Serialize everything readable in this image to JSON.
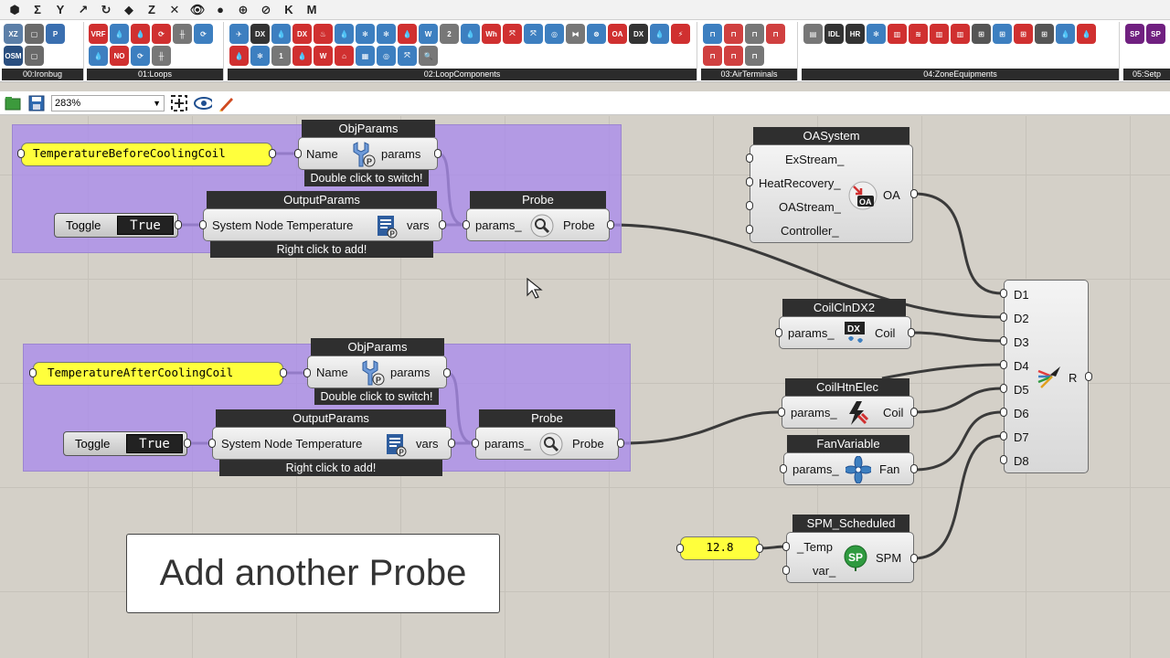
{
  "topbar": {
    "items": [
      "⬢",
      "Σ",
      "Y",
      "↗",
      "↻",
      "◆",
      "Z",
      "✕",
      "👁",
      "●",
      "⊕",
      "⊘",
      "K",
      "M"
    ]
  },
  "ribbon": {
    "groups": [
      {
        "label": "00:Ironbug",
        "color": "#3a6fb0"
      },
      {
        "label": "01:Loops",
        "color": "#d03030"
      },
      {
        "label": "02:LoopComponents",
        "color": "#3d7fc0"
      },
      {
        "label": "03:AirTerminals",
        "color": "#d04040"
      },
      {
        "label": "04:ZoneEquipments",
        "color": "#2f6aa8"
      },
      {
        "label": "05:Setp",
        "color": "#702080"
      }
    ]
  },
  "toolbar": {
    "zoom_value": "283%"
  },
  "canvas": {
    "group1": {
      "panel_text": "TemperatureBeforeCoolingCoil",
      "objparams": {
        "title": "ObjParams",
        "input": "Name",
        "output": "params",
        "footer": "Double click to switch!"
      },
      "toggle": {
        "label": "Toggle",
        "value": "True"
      },
      "outputparams": {
        "title": "OutputParams",
        "input": "System Node Temperature",
        "output": "vars",
        "footer": "Right click to add!"
      },
      "probe": {
        "title": "Probe",
        "input": "params_",
        "output": "Probe"
      }
    },
    "group2": {
      "panel_text": "TemperatureAfterCoolingCoil",
      "objparams": {
        "title": "ObjParams",
        "input": "Name",
        "output": "params",
        "footer": "Double click to switch!"
      },
      "toggle": {
        "label": "Toggle",
        "value": "True"
      },
      "outputparams": {
        "title": "OutputParams",
        "input": "System Node Temperature",
        "output": "vars",
        "footer": "Right click to add!"
      },
      "probe": {
        "title": "Probe",
        "input": "params_",
        "output": "Probe"
      }
    },
    "oasystem": {
      "title": "OASystem",
      "inputs": [
        "ExStream_",
        "HeatRecovery_",
        "OAStream_",
        "Controller_"
      ],
      "output": "OA"
    },
    "coil_cooling": {
      "title": "CoilClnDX2",
      "input": "params_",
      "output": "Coil"
    },
    "coil_heating": {
      "title": "CoilHtnElec",
      "input": "params_",
      "output": "Coil"
    },
    "fan": {
      "title": "FanVariable",
      "input": "params_",
      "output": "Fan"
    },
    "spm": {
      "title": "SPM_Scheduled",
      "inputs": [
        "_Temp",
        "var_"
      ],
      "output": "SPM"
    },
    "spm_value": "12.8",
    "merge": {
      "inputs": [
        "D1",
        "D2",
        "D3",
        "D4",
        "D5",
        "D6",
        "D7",
        "D8"
      ],
      "output": "R"
    },
    "caption": "Add another Probe"
  }
}
